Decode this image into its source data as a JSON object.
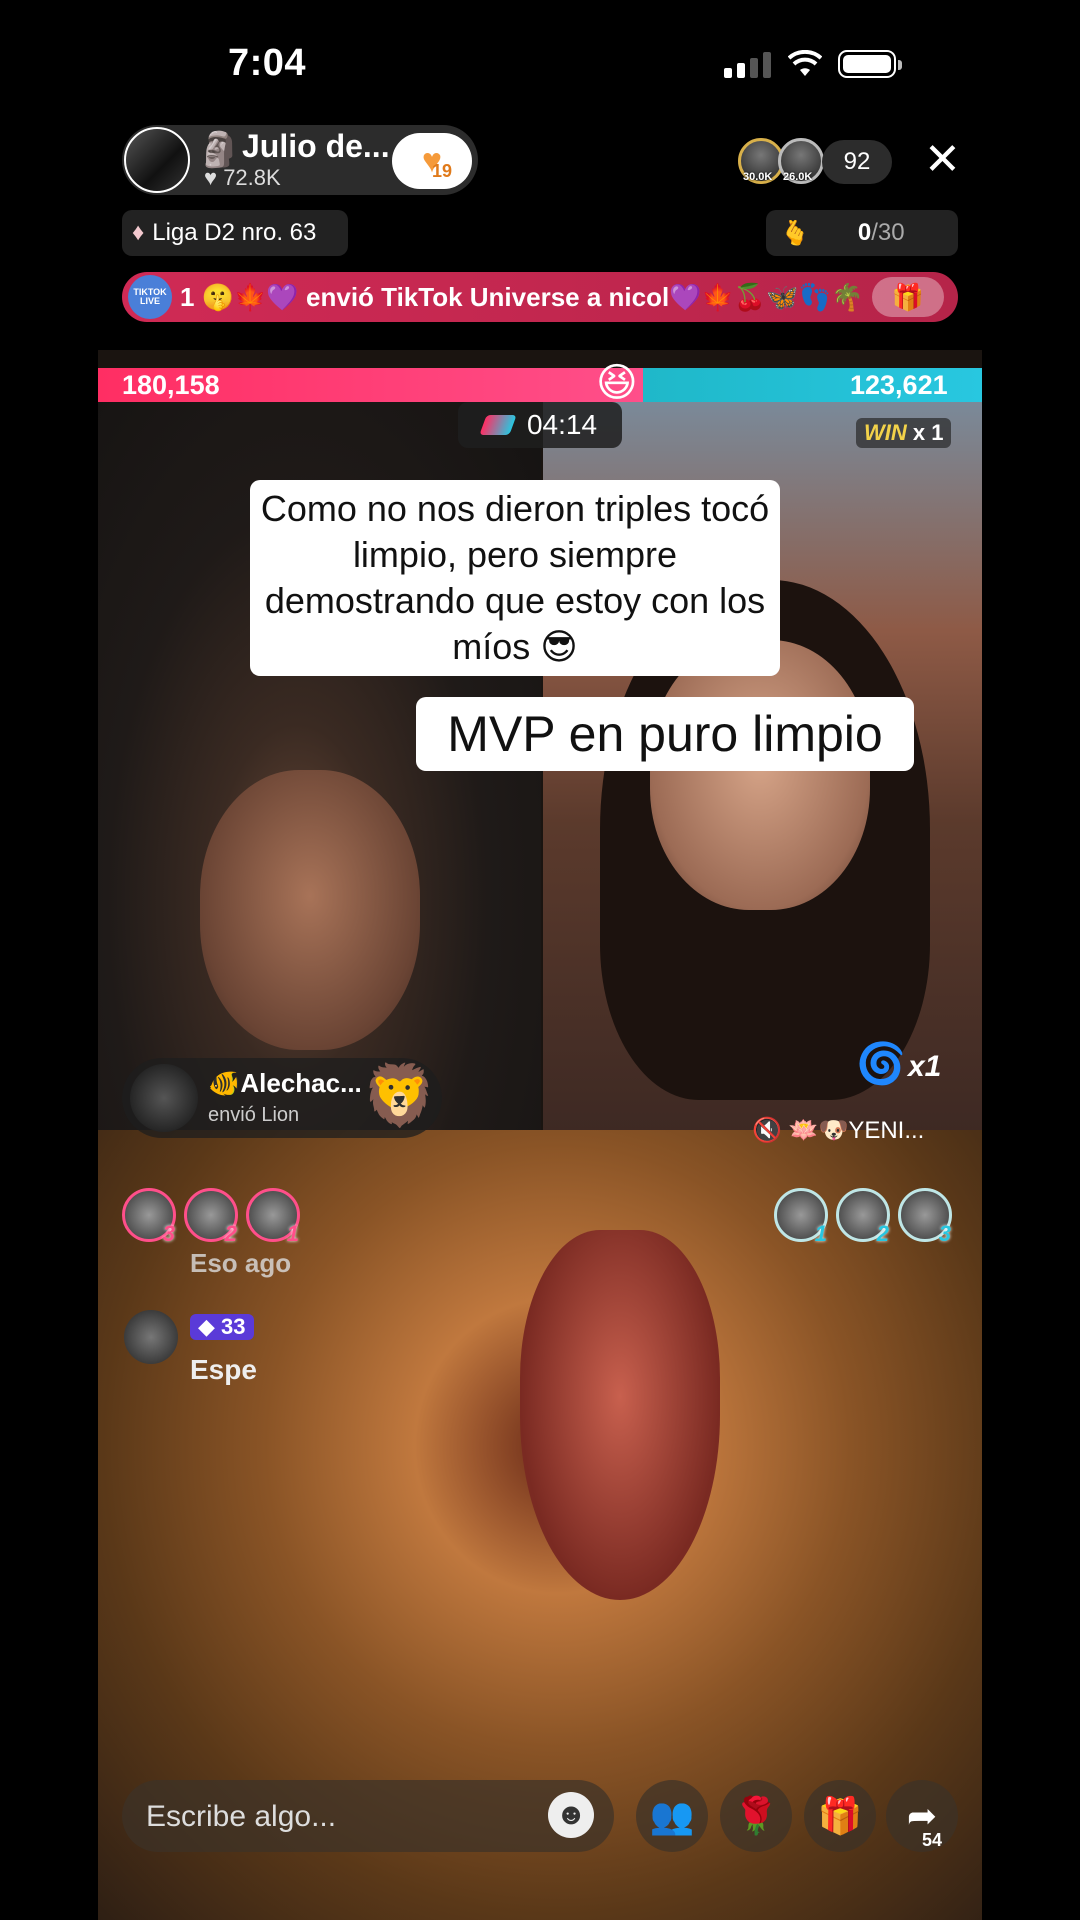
{
  "status_bar": {
    "time": "7:04"
  },
  "header": {
    "host_name": "Julio de...",
    "host_likes": "72.8K",
    "follow_count": "19",
    "top_viewers": [
      "30.0K",
      "26.0K"
    ],
    "viewer_count": "92",
    "league": "Liga D2 nro. 63",
    "goal_current": "0",
    "goal_total": "/30"
  },
  "banner": {
    "badge": "TIKTOK LIVE",
    "text": "1 🤫🍁💜 envió TikTok Universe a nicol💜🍁🍒🦋👣🌴"
  },
  "battle": {
    "score_left": "180,158",
    "score_right": "123,621",
    "timer": "04:14",
    "win_label": "WIN",
    "win_count": "x 1"
  },
  "captions": {
    "line1": "Como no nos dieron triples tocó limpio, pero siempre demostrando que estoy con los míos 😎",
    "line2": "MVP en puro limpio"
  },
  "gift_notice": {
    "user": "🐠Alechac...",
    "action": "envió Lion"
  },
  "right_overlay": {
    "multiplier": "x1",
    "guest": "🪷🐶YENI..."
  },
  "supporters_left": [
    "3",
    "2",
    "1"
  ],
  "supporters_right": [
    "1",
    "2",
    "3"
  ],
  "chat": {
    "msg1": "Eso ago",
    "badge": "33",
    "msg2": "Espe"
  },
  "bottom_bar": {
    "placeholder": "Escribe algo...",
    "share_count": "54"
  }
}
